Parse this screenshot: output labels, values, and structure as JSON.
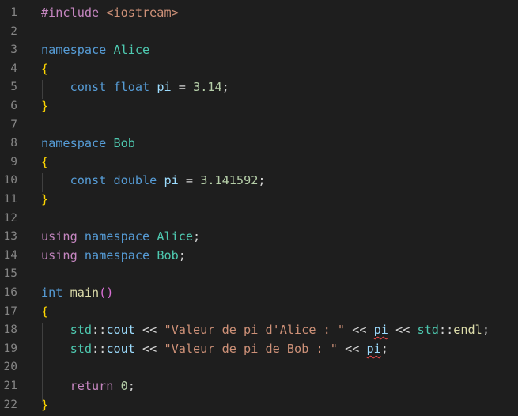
{
  "editor": {
    "language": "cpp",
    "colors": {
      "background": "#1e1e1e",
      "gutter_text": "#858585",
      "keyword_control": "#c586c0",
      "keyword": "#569cd6",
      "type": "#4ec9b0",
      "variable": "#9cdcfe",
      "number": "#b5cea8",
      "string": "#ce9178",
      "function": "#dcdcaa",
      "brace": "#ffd700",
      "error_squiggle": "#f14c4c"
    },
    "lines": [
      {
        "number": "1",
        "tokens": [
          {
            "t": "#include ",
            "c": "kw-ctrl"
          },
          {
            "t": "<iostream>",
            "c": "str"
          }
        ]
      },
      {
        "number": "2",
        "tokens": []
      },
      {
        "number": "3",
        "tokens": [
          {
            "t": "namespace ",
            "c": "kw"
          },
          {
            "t": "Alice",
            "c": "type"
          }
        ]
      },
      {
        "number": "4",
        "tokens": [
          {
            "t": "{",
            "c": "brace"
          }
        ]
      },
      {
        "number": "5",
        "tokens": [
          {
            "t": "    ",
            "c": "op"
          },
          {
            "t": "const ",
            "c": "kw"
          },
          {
            "t": "float ",
            "c": "kw"
          },
          {
            "t": "pi",
            "c": "var"
          },
          {
            "t": " = ",
            "c": "op"
          },
          {
            "t": "3.14",
            "c": "num"
          },
          {
            "t": ";",
            "c": "op"
          }
        ]
      },
      {
        "number": "6",
        "tokens": [
          {
            "t": "}",
            "c": "brace"
          }
        ]
      },
      {
        "number": "7",
        "tokens": []
      },
      {
        "number": "8",
        "tokens": [
          {
            "t": "namespace ",
            "c": "kw"
          },
          {
            "t": "Bob",
            "c": "type"
          }
        ]
      },
      {
        "number": "9",
        "tokens": [
          {
            "t": "{",
            "c": "brace"
          }
        ]
      },
      {
        "number": "10",
        "tokens": [
          {
            "t": "    ",
            "c": "op"
          },
          {
            "t": "const ",
            "c": "kw"
          },
          {
            "t": "double ",
            "c": "kw"
          },
          {
            "t": "pi",
            "c": "var"
          },
          {
            "t": " = ",
            "c": "op"
          },
          {
            "t": "3.141592",
            "c": "num"
          },
          {
            "t": ";",
            "c": "op"
          }
        ]
      },
      {
        "number": "11",
        "tokens": [
          {
            "t": "}",
            "c": "brace"
          }
        ]
      },
      {
        "number": "12",
        "tokens": []
      },
      {
        "number": "13",
        "tokens": [
          {
            "t": "using ",
            "c": "kw-ctrl"
          },
          {
            "t": "namespace ",
            "c": "kw"
          },
          {
            "t": "Alice",
            "c": "type"
          },
          {
            "t": ";",
            "c": "op"
          }
        ]
      },
      {
        "number": "14",
        "tokens": [
          {
            "t": "using ",
            "c": "kw-ctrl"
          },
          {
            "t": "namespace ",
            "c": "kw"
          },
          {
            "t": "Bob",
            "c": "type"
          },
          {
            "t": ";",
            "c": "op"
          }
        ]
      },
      {
        "number": "15",
        "tokens": []
      },
      {
        "number": "16",
        "tokens": [
          {
            "t": "int ",
            "c": "kw"
          },
          {
            "t": "main",
            "c": "fn"
          },
          {
            "t": "()",
            "c": "paren"
          }
        ]
      },
      {
        "number": "17",
        "tokens": [
          {
            "t": "{",
            "c": "brace"
          }
        ]
      },
      {
        "number": "18",
        "tokens": [
          {
            "t": "    ",
            "c": "op"
          },
          {
            "t": "std",
            "c": "type"
          },
          {
            "t": "::",
            "c": "op"
          },
          {
            "t": "cout",
            "c": "var"
          },
          {
            "t": " << ",
            "c": "op"
          },
          {
            "t": "\"Valeur de pi d'Alice : \"",
            "c": "str"
          },
          {
            "t": " << ",
            "c": "op"
          },
          {
            "t": "pi",
            "c": "var",
            "error": true
          },
          {
            "t": " << ",
            "c": "op"
          },
          {
            "t": "std",
            "c": "type"
          },
          {
            "t": "::",
            "c": "op"
          },
          {
            "t": "endl",
            "c": "fn"
          },
          {
            "t": ";",
            "c": "op"
          }
        ]
      },
      {
        "number": "19",
        "tokens": [
          {
            "t": "    ",
            "c": "op"
          },
          {
            "t": "std",
            "c": "type"
          },
          {
            "t": "::",
            "c": "op"
          },
          {
            "t": "cout",
            "c": "var"
          },
          {
            "t": " << ",
            "c": "op"
          },
          {
            "t": "\"Valeur de pi de Bob : \"",
            "c": "str"
          },
          {
            "t": " << ",
            "c": "op"
          },
          {
            "t": "pi",
            "c": "var",
            "error": true
          },
          {
            "t": ";",
            "c": "op"
          }
        ]
      },
      {
        "number": "20",
        "tokens": []
      },
      {
        "number": "21",
        "tokens": [
          {
            "t": "    ",
            "c": "op"
          },
          {
            "t": "return ",
            "c": "kw-ctrl"
          },
          {
            "t": "0",
            "c": "num"
          },
          {
            "t": ";",
            "c": "op"
          }
        ]
      },
      {
        "number": "22",
        "tokens": [
          {
            "t": "}",
            "c": "brace"
          }
        ]
      }
    ]
  }
}
